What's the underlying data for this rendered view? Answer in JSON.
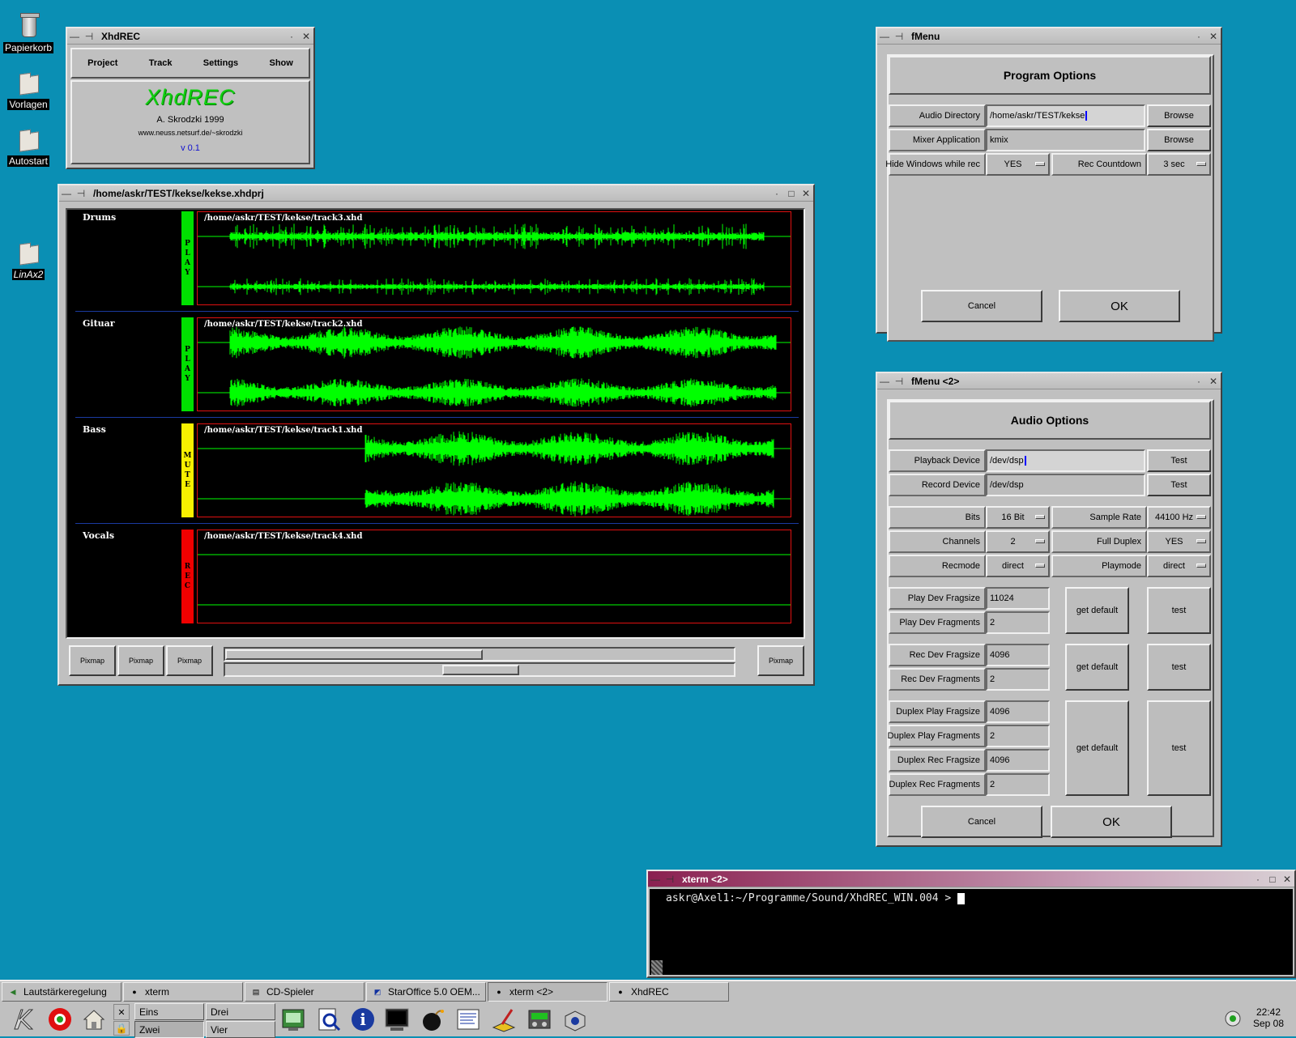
{
  "desktop": {
    "icons": [
      {
        "label": "Papierkorb",
        "icon": "trash-icon"
      },
      {
        "label": "Vorlagen",
        "icon": "folder-icon"
      },
      {
        "label": "Autostart",
        "icon": "folder-icon"
      },
      {
        "label": "LinAx2",
        "icon": "folder-link-icon"
      }
    ]
  },
  "about_window": {
    "title": "XhdREC",
    "menu": [
      "Project",
      "Track",
      "Settings",
      "Show"
    ],
    "logo": "XhdREC",
    "author": "A. Skrodzki 1999",
    "url": "www.neuss.netsurf.de/~skrodzki",
    "version": "v 0.1"
  },
  "project_window": {
    "title": "/home/askr/TEST/kekse/kekse.xhdprj",
    "tracks": [
      {
        "name": "Drums",
        "state": "PLAY",
        "file": "/home/askr/TEST/kekse/track3.xhd",
        "state_color": "#00e000"
      },
      {
        "name": "Gituar",
        "state": "PLAY",
        "file": "/home/askr/TEST/kekse/track2.xhd",
        "state_color": "#00e000"
      },
      {
        "name": "Bass",
        "state": "MUTE",
        "file": "/home/askr/TEST/kekse/track1.xhd",
        "state_color": "#f8f000"
      },
      {
        "name": "Vocals",
        "state": "REC",
        "file": "/home/askr/TEST/kekse/track4.xhd",
        "state_color": "#f00000"
      }
    ],
    "buttons": [
      "Pixmap",
      "Pixmap",
      "Pixmap",
      "Pixmap"
    ],
    "colors": {
      "wave": "#00ff00",
      "wave_border": "#e01010",
      "separator": "#1a3aa0"
    }
  },
  "program_options": {
    "title": "fMenu",
    "heading": "Program Options",
    "audio_dir_label": "Audio Directory",
    "audio_dir_value": "/home/askr/TEST/kekse",
    "mixer_label": "Mixer Application",
    "mixer_value": "kmix",
    "browse": "Browse",
    "hide_label": "Hide Windows while rec",
    "hide_value": "YES",
    "countdown_label": "Rec Countdown",
    "countdown_value": "3 sec",
    "cancel": "Cancel",
    "ok": "OK"
  },
  "audio_options": {
    "title": "fMenu <2>",
    "heading": "Audio Options",
    "playback_label": "Playback Device",
    "playback_value": "/dev/dsp",
    "record_label": "Record Device",
    "record_value": "/dev/dsp",
    "test": "Test",
    "bits_label": "Bits",
    "bits_value": "16 Bit",
    "rate_label": "Sample Rate",
    "rate_value": "44100 Hz",
    "channels_label": "Channels",
    "channels_value": "2",
    "duplex_label": "Full Duplex",
    "duplex_value": "YES",
    "recmode_label": "Recmode",
    "recmode_value": "direct",
    "playmode_label": "Playmode",
    "playmode_value": "direct",
    "play_fragsize_label": "Play Dev Fragsize",
    "play_fragsize_value": "11024",
    "play_fragments_label": "Play Dev Fragments",
    "play_fragments_value": "2",
    "rec_fragsize_label": "Rec Dev Fragsize",
    "rec_fragsize_value": "4096",
    "rec_fragments_label": "Rec Dev Fragments",
    "rec_fragments_value": "2",
    "dup_play_fragsize_label": "Duplex Play Fragsize",
    "dup_play_fragsize_value": "4096",
    "dup_play_fragments_label": "Duplex Play Fragments",
    "dup_play_fragments_value": "2",
    "dup_rec_fragsize_label": "Duplex Rec Fragsize",
    "dup_rec_fragsize_value": "4096",
    "dup_rec_fragments_label": "Duplex Rec Fragments",
    "dup_rec_fragments_value": "2",
    "get_default": "get default",
    "test_lower": "test",
    "cancel": "Cancel",
    "ok": "OK"
  },
  "xterm": {
    "title": "xterm <2>",
    "prompt": "askr@Axel1:~/Programme/Sound/XhdREC_WIN.004 > "
  },
  "taskbar": {
    "tasks": [
      "Lautstärkeregelung",
      "xterm",
      "CD-Spieler",
      "StarOffice 5.0 OEM...",
      "xterm <2>",
      "XhdREC"
    ]
  },
  "panel": {
    "desktops": [
      "Eins",
      "Drei",
      "Zwei",
      "Vier"
    ],
    "clock_time": "22:42",
    "clock_date": "Sep 08"
  }
}
